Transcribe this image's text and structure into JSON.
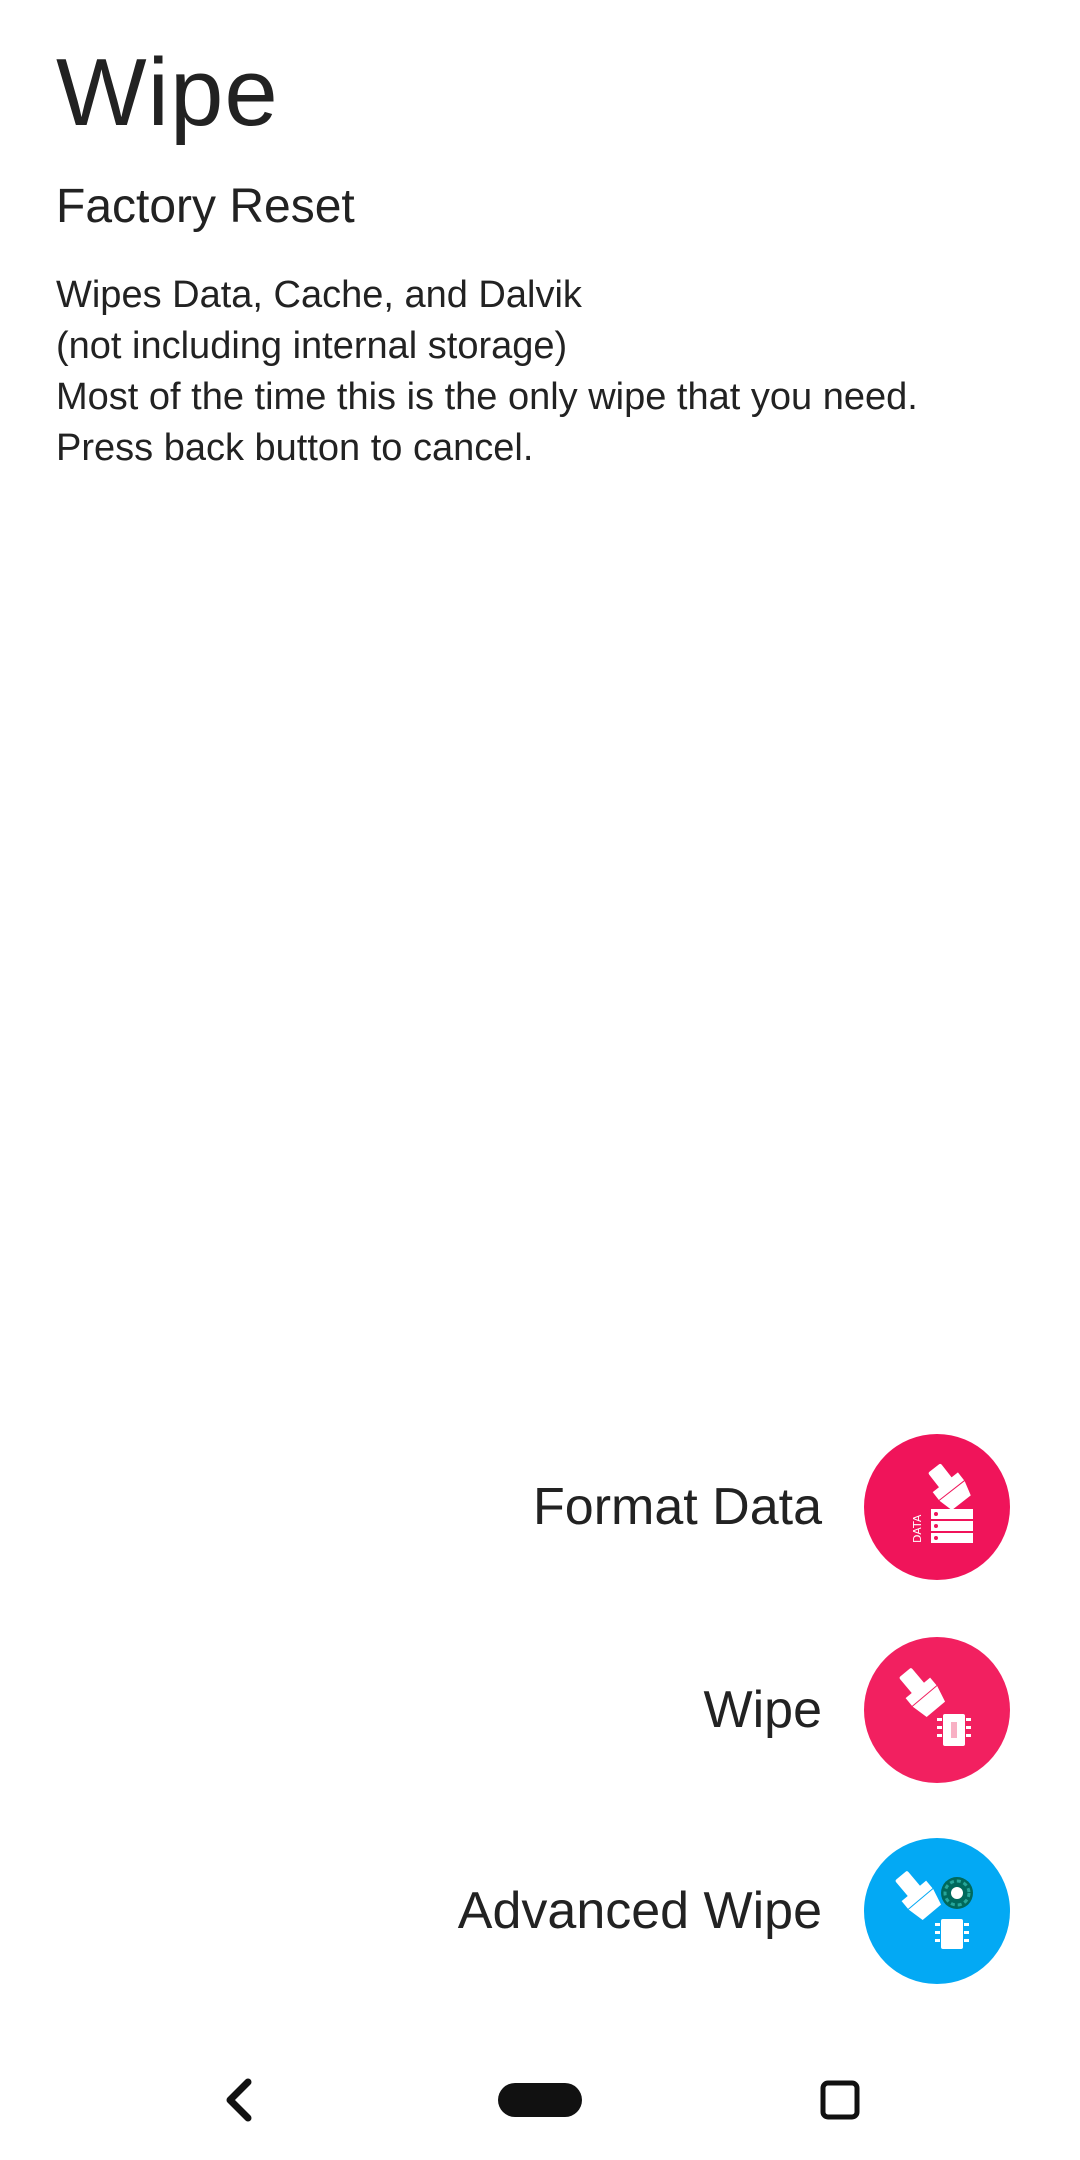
{
  "page": {
    "title": "Wipe",
    "section_title": "Factory Reset",
    "description_lines": [
      "Wipes Data, Cache, and Dalvik",
      "(not including internal storage)",
      "Most of the time this is the only wipe that you need.",
      "Press back button to cancel."
    ]
  },
  "actions": [
    {
      "label": "Format Data",
      "icon": "format-data-icon",
      "color": "#F0145A"
    },
    {
      "label": "Wipe",
      "icon": "wipe-icon",
      "color": "#F22060"
    },
    {
      "label": "Advanced Wipe",
      "icon": "advanced-wipe-icon",
      "color": "#03A9F4"
    }
  ],
  "navbar": {
    "back_icon": "back-icon",
    "home_icon": "home-pill-icon",
    "recents_icon": "recents-icon"
  }
}
